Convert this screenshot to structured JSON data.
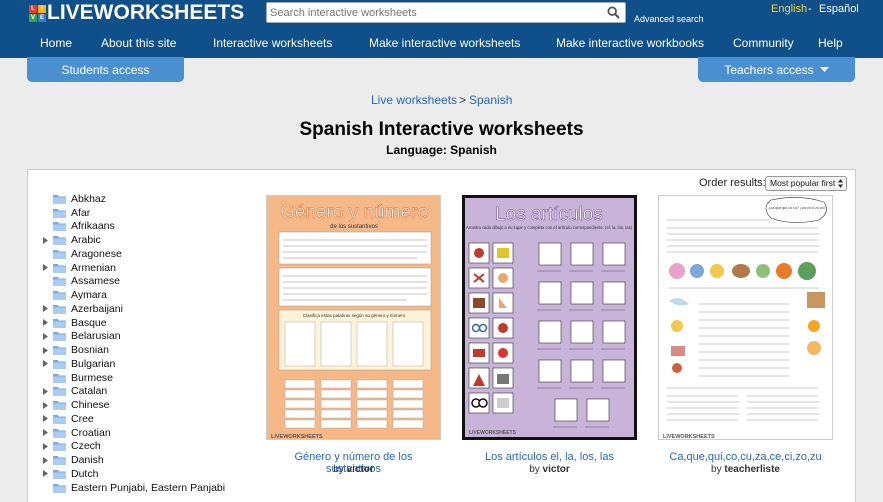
{
  "header": {
    "logo_mark": [
      "L",
      "I",
      "V",
      "E"
    ],
    "logo_text": "LIVEWORKSHEETS",
    "search_placeholder": "Search interactive worksheets",
    "advanced_search": "Advanced search",
    "lang_english": "English",
    "lang_sep": "-",
    "lang_spanish": "Español",
    "nav": [
      "Home",
      "About this site",
      "Interactive worksheets",
      "Make interactive worksheets",
      "Make interactive workbooks",
      "Community",
      "Help"
    ],
    "students_access": "Students access",
    "teachers_access": "Teachers access"
  },
  "breadcrumb": {
    "root": "Live worksheets",
    "sep": ">",
    "current": "Spanish"
  },
  "page": {
    "title": "Spanish Interactive worksheets",
    "subtitle": "Language: Spanish",
    "order_label": "Order results:",
    "order_value": "Most popular first"
  },
  "languages": [
    {
      "name": "Abkhaz",
      "expandable": false
    },
    {
      "name": "Afar",
      "expandable": false
    },
    {
      "name": "Afrikaans",
      "expandable": false
    },
    {
      "name": "Arabic",
      "expandable": true
    },
    {
      "name": "Aragonese",
      "expandable": false
    },
    {
      "name": "Armenian",
      "expandable": true
    },
    {
      "name": "Assamese",
      "expandable": false
    },
    {
      "name": "Aymara",
      "expandable": false
    },
    {
      "name": "Azerbaijani",
      "expandable": true
    },
    {
      "name": "Basque",
      "expandable": true
    },
    {
      "name": "Belarusian",
      "expandable": true
    },
    {
      "name": "Bosnian",
      "expandable": true
    },
    {
      "name": "Bulgarian",
      "expandable": true
    },
    {
      "name": "Burmese",
      "expandable": false
    },
    {
      "name": "Catalan",
      "expandable": true
    },
    {
      "name": "Chinese",
      "expandable": true
    },
    {
      "name": "Cree",
      "expandable": true
    },
    {
      "name": "Croatian",
      "expandable": true
    },
    {
      "name": "Czech",
      "expandable": true
    },
    {
      "name": "Danish",
      "expandable": true
    },
    {
      "name": "Dutch",
      "expandable": true
    },
    {
      "name": "Eastern Punjabi, Eastern Panjabi",
      "expandable": false
    }
  ],
  "worksheets": [
    {
      "title": "Género y número de los sustantivos",
      "by": "by",
      "author": "victor",
      "thumb_heading": "Género y número",
      "thumb_sub": "de los sustantivos",
      "thumb_box_label": "Clasifica estas palabras según su género y número",
      "thumb_footer": "LIVEWORKSHEETS"
    },
    {
      "title": "Los artículos el, la, los, las",
      "by": "by",
      "author": "victor",
      "thumb_heading": "Los artículos",
      "thumb_sub": "Arrastra cada dibujo a su lugar y completa con el artículo correspondiente. (el, la, los, las)",
      "thumb_footer": "LIVEWORKSHEETS"
    },
    {
      "title": "Ca,que,qui,co,cu,za,ce,ci,zo,zu",
      "by": "by",
      "author": "teacherliste",
      "thumb_bubble": "¿ca que qui co cu? ¿za ce ci zo zu?",
      "thumb_footer": "LIVEWORKSHEETS"
    }
  ],
  "colors": {
    "header_bg": "#0f4f8a",
    "tab_bg": "#4a8fd0",
    "link": "#2468c8",
    "thumb1_bg": "#f7b888",
    "thumb2_bg": "#c8b4d8"
  }
}
